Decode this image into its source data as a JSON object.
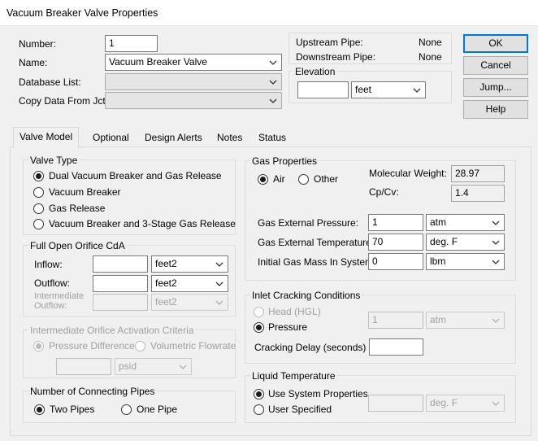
{
  "window": {
    "title": "Vacuum Breaker Valve Properties"
  },
  "header": {
    "number_label": "Number:",
    "number_value": "1",
    "name_label": "Name:",
    "name_value": "Vacuum Breaker Valve",
    "database_label": "Database List:",
    "copy_label": "Copy Data From Jct...",
    "upstream_label": "Upstream Pipe:",
    "upstream_value": "None",
    "downstream_label": "Downstream Pipe:",
    "downstream_value": "None",
    "elevation_label": "Elevation",
    "elevation_value": "",
    "elevation_unit": "feet"
  },
  "buttons": {
    "ok": "OK",
    "cancel": "Cancel",
    "jump": "Jump...",
    "help": "Help"
  },
  "tabs": [
    {
      "label": "Valve Model",
      "active": true
    },
    {
      "label": "Optional"
    },
    {
      "label": "Design Alerts"
    },
    {
      "label": "Notes"
    },
    {
      "label": "Status"
    }
  ],
  "valve_type": {
    "label": "Valve Type",
    "options": [
      "Dual Vacuum Breaker and Gas Release",
      "Vacuum Breaker",
      "Gas Release",
      "Vacuum Breaker and 3-Stage Gas Release"
    ],
    "selected": 0
  },
  "orifice": {
    "label": "Full Open Orifice CdA",
    "inflow_label": "Inflow:",
    "inflow_unit": "feet2",
    "outflow_label": "Outflow:",
    "outflow_unit": "feet2",
    "intermediate_label_1": "Intermediate",
    "intermediate_label_2": "Outflow:",
    "intermediate_unit": "feet2"
  },
  "activation": {
    "label": "Intermediate Orifice Activation Criteria",
    "pressure_diff": "Pressure Difference",
    "vol_flow": "Volumetric Flowrate",
    "unit": "psid"
  },
  "connecting": {
    "label": "Number of Connecting Pipes",
    "two": "Two Pipes",
    "one": "One Pipe"
  },
  "gas": {
    "label": "Gas Properties",
    "air": "Air",
    "other": "Other",
    "mw_label": "Molecular Weight:",
    "mw_value": "28.97",
    "cpcv_label": "Cp/Cv:",
    "cpcv_value": "1.4",
    "ext_pressure_label": "Gas External Pressure:",
    "ext_pressure_value": "1",
    "ext_pressure_unit": "atm",
    "ext_temp_label": "Gas External Temperature:",
    "ext_temp_value": "70",
    "ext_temp_unit": "deg. F",
    "mass_label": "Initial Gas Mass In System:",
    "mass_value": "0",
    "mass_unit": "lbm"
  },
  "cracking": {
    "label": "Inlet Cracking Conditions",
    "head": "Head (HGL)",
    "pressure": "Pressure",
    "value": "1",
    "unit": "atm",
    "delay_label": "Cracking Delay (seconds)",
    "delay_value": ""
  },
  "liquid": {
    "label": "Liquid Temperature",
    "system": "Use System Properties",
    "user": "User Specified",
    "unit": "deg. F"
  }
}
